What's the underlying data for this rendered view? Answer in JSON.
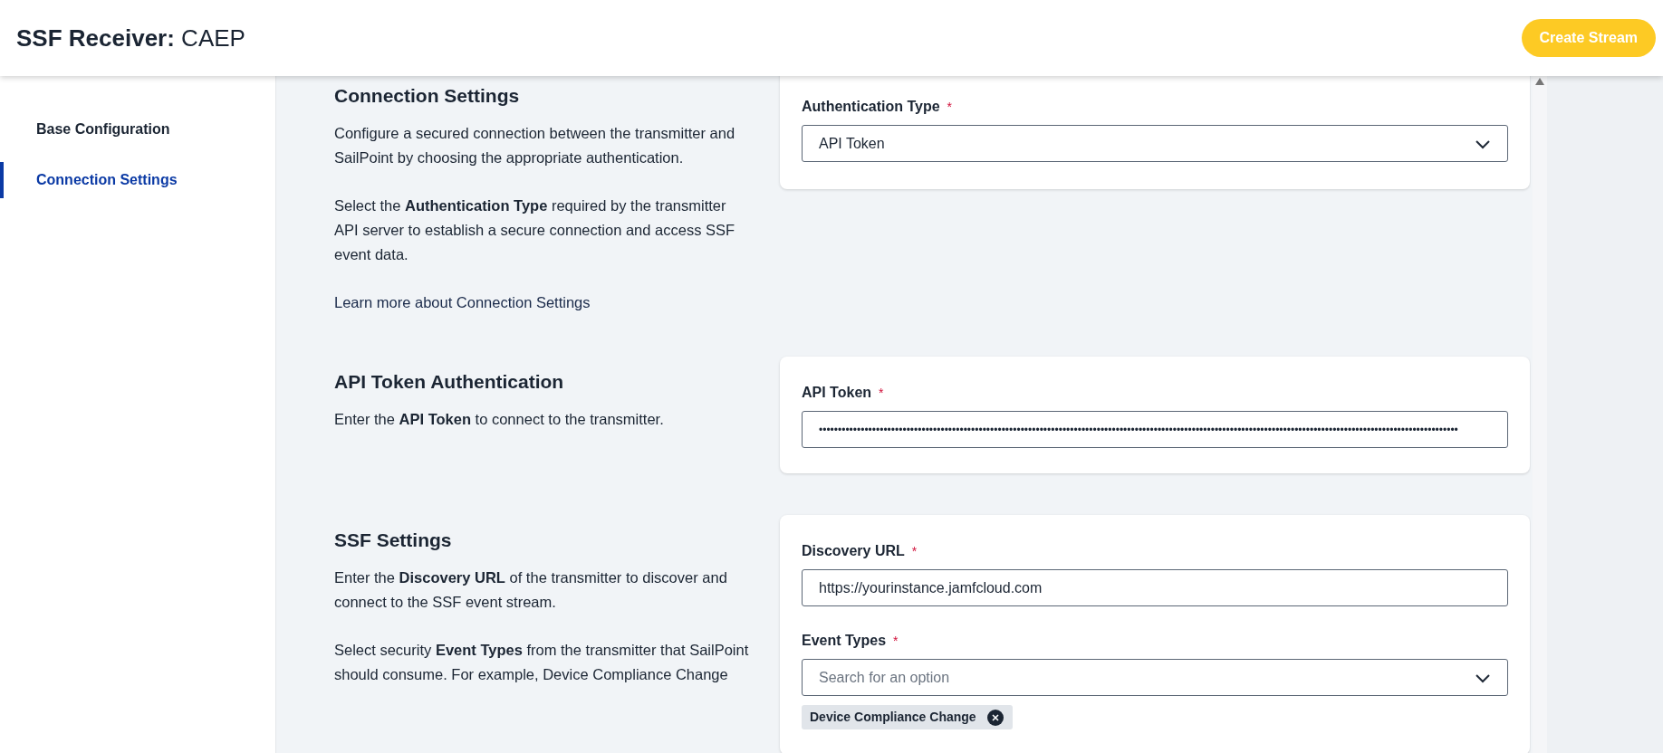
{
  "header": {
    "title_bold": "SSF Receiver:",
    "title_rest": "CAEP",
    "action": "Create Stream"
  },
  "sidebar": {
    "items": [
      {
        "label": "Base Configuration",
        "selected": false
      },
      {
        "label": "Connection Settings",
        "selected": true
      }
    ]
  },
  "sections": [
    {
      "heading": "Connection Settings",
      "paragraphs": [
        "Configure a secured connection between the transmitter and SailPoint by choosing the appropriate authentication.",
        "Select the **Authentication Type** required by the transmitter API server to establish a secure connection and access SSF event data."
      ],
      "link": "Learn more about Connection Settings",
      "fields": [
        {
          "kind": "select",
          "label": "Authentication Type",
          "required_mark": "*",
          "value": "API Token"
        }
      ]
    },
    {
      "heading": "API Token Authentication",
      "paragraphs": [
        "Enter the **API Token** to connect to the transmitter."
      ],
      "fields": [
        {
          "kind": "password",
          "label": "API Token",
          "required_mark": "*",
          "value": "••••••••••••••••••••••••••••••••••••••••••••••••••••••••••••••••••••••••••••••••••••••••••••••••••••••••••••••••••••••••••••••••••••••••••••••••••••••••••••••••••••••••"
        }
      ]
    },
    {
      "heading": "SSF Settings",
      "paragraphs": [
        "Enter the **Discovery URL** of the transmitter to discover and connect to the SSF event stream.",
        "Select security **Event Types** from the transmitter that SailPoint should consume. For example, Device Compliance Change"
      ],
      "fields": [
        {
          "kind": "text",
          "label": "Discovery URL",
          "required_mark": "*",
          "value": "https://yourinstance.jamfcloud.com"
        },
        {
          "kind": "multiselect",
          "label": "Event Types",
          "required_mark": "*",
          "placeholder": "Search for an option",
          "chips": [
            "Device Compliance Change"
          ]
        }
      ]
    }
  ]
}
